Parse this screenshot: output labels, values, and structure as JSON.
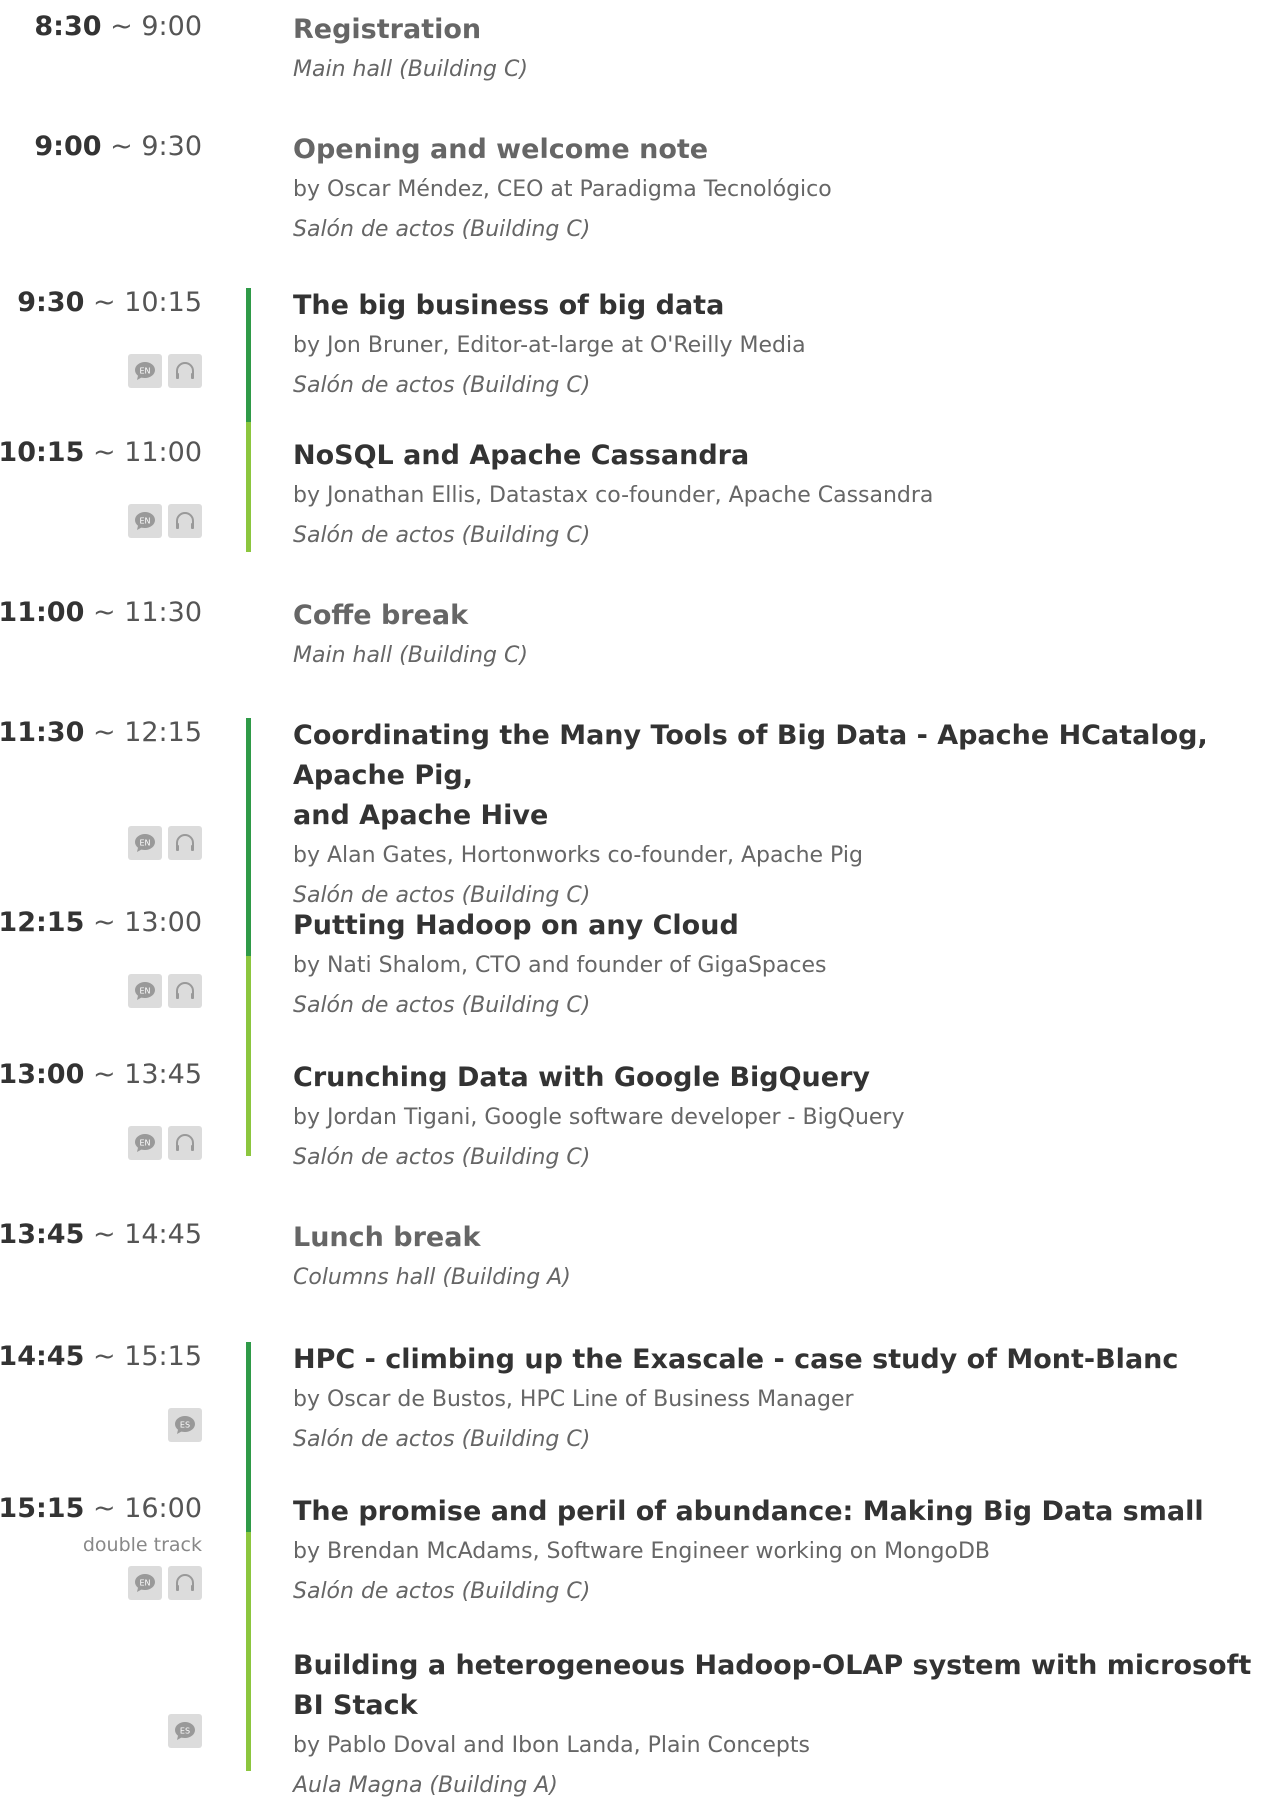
{
  "colors": {
    "bar_dark": "#2f9a48",
    "bar_light": "#8cc63e",
    "badge_bg": "#dcdcdc",
    "badge_icon": "#999999"
  },
  "icons": {
    "lang": "speech-bubble-icon",
    "translation": "headphones-icon"
  },
  "sessions": [
    {
      "start": "8:30",
      "tilde": "~",
      "end": "9:00",
      "title": "Registration",
      "speaker": "",
      "room": "Main hall (Building C)",
      "note": "",
      "badges": []
    },
    {
      "start": "9:00",
      "tilde": "~",
      "end": "9:30",
      "title": "Opening and welcome note",
      "speaker": "by Oscar Méndez, CEO at Paradigma Tecnológico",
      "room": "Salón de actos (Building C)",
      "note": "",
      "badges": []
    },
    {
      "start": "9:30",
      "tilde": "~",
      "end": "10:15",
      "title": "The big business of big data",
      "speaker": "by Jon Bruner, Editor-at-large at O'Reilly Media",
      "room": "Salón de actos (Building C)",
      "note": "",
      "badges": [
        "EN",
        "headphones"
      ]
    },
    {
      "start": "10:15",
      "tilde": "~",
      "end": "11:00",
      "title": "NoSQL and Apache Cassandra",
      "speaker": "by Jonathan Ellis, Datastax co-founder, Apache Cassandra",
      "room": "Salón de actos (Building C)",
      "note": "",
      "badges": [
        "EN",
        "headphones"
      ]
    },
    {
      "start": "11:00",
      "tilde": "~",
      "end": "11:30",
      "title": "Coffe break",
      "speaker": "",
      "room": "Main hall (Building C)",
      "note": "",
      "badges": []
    },
    {
      "start": "11:30",
      "tilde": "~",
      "end": "12:15",
      "title_lines": [
        "Coordinating the Many Tools of Big Data - Apache HCatalog, Apache Pig,",
        "and Apache Hive"
      ],
      "speaker": "by Alan Gates, Hortonworks co-founder, Apache Pig",
      "room": "Salón de actos (Building C)",
      "note": "",
      "badges": [
        "EN",
        "headphones"
      ]
    },
    {
      "start": "12:15",
      "tilde": "~",
      "end": "13:00",
      "title": "Putting Hadoop on any Cloud",
      "speaker": "by Nati Shalom, CTO and founder of GigaSpaces",
      "room": "Salón de actos (Building C)",
      "note": "",
      "badges": [
        "EN",
        "headphones"
      ]
    },
    {
      "start": "13:00",
      "tilde": "~",
      "end": "13:45",
      "title": "Crunching Data with Google BigQuery",
      "speaker": "by Jordan Tigani, Google software developer - BigQuery",
      "room": "Salón de actos (Building C)",
      "note": "",
      "badges": [
        "EN",
        "headphones"
      ]
    },
    {
      "start": "13:45",
      "tilde": "~",
      "end": "14:45",
      "title": "Lunch break",
      "speaker": "",
      "room": "Columns hall (Building A)",
      "note": "",
      "badges": []
    },
    {
      "start": "14:45",
      "tilde": "~",
      "end": "15:15",
      "title": "HPC - climbing up the Exascale - case study of Mont-Blanc",
      "speaker": "by Oscar de Bustos, HPC Line of Business Manager",
      "room": "Salón de actos (Building C)",
      "note": "",
      "badges": [
        "ES"
      ]
    },
    {
      "start": "15:15",
      "tilde": "~",
      "end": "16:00",
      "title": "The promise and peril of abundance: Making Big Data small",
      "speaker": "by Brendan McAdams, Software Engineer working on MongoDB",
      "room": "Salón de actos (Building C)",
      "note": "double track",
      "badges": [
        "EN",
        "headphones"
      ]
    },
    {
      "start": "",
      "tilde": "",
      "end": "",
      "title": "Building a heterogeneous Hadoop-OLAP system with microsoft BI Stack",
      "speaker": "by Pablo Doval and Ibon Landa, Plain Concepts",
      "room": "Aula Magna (Building A)",
      "note": "",
      "badges": [
        "ES"
      ]
    }
  ]
}
